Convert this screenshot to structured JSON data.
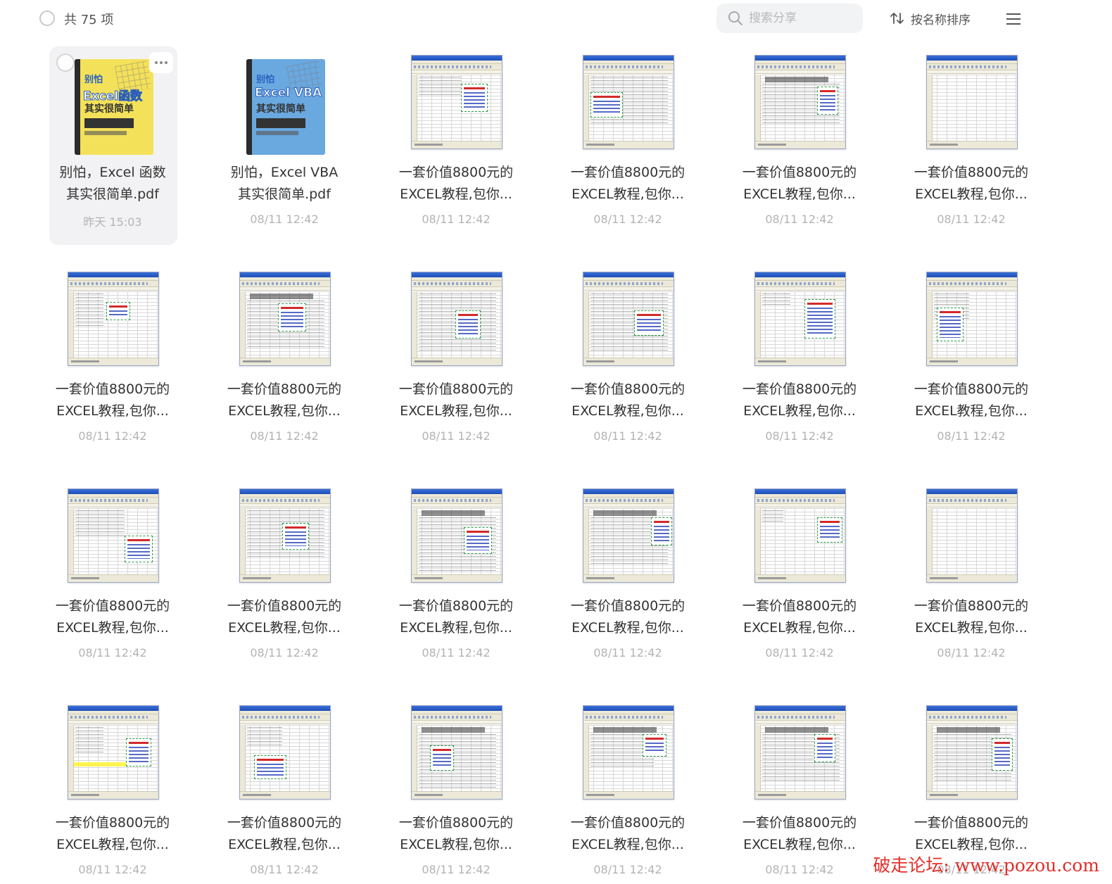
{
  "toolbar": {
    "count_label": "共 75 项",
    "search_placeholder": "搜索分享",
    "sort_label": "按名称排序"
  },
  "files": [
    {
      "name_line1": "别怕，Excel 函数",
      "name_line2": "其实很简单.pdf",
      "time": "昨天 15:03",
      "kind": "book",
      "cover": {
        "line1": "别怕",
        "line2": "Excel函数",
        "line3": "其实很简单",
        "color": "#f4e15a"
      }
    },
    {
      "name_line1": "别怕，Excel VBA",
      "name_line2": "其实很简单.pdf",
      "time": "08/11 12:42",
      "kind": "book",
      "cover": {
        "line1": "别怕",
        "line2": "Excel VBA",
        "line3": "其实很简单",
        "color": "#6aa8e0"
      }
    },
    {
      "name_line1": "一套价值8800元的",
      "name_line2": "EXCEL教程,包你...",
      "time": "08/11 12:42",
      "kind": "xls"
    },
    {
      "name_line1": "一套价值8800元的",
      "name_line2": "EXCEL教程,包你...",
      "time": "08/11 12:42",
      "kind": "xls"
    },
    {
      "name_line1": "一套价值8800元的",
      "name_line2": "EXCEL教程,包你...",
      "time": "08/11 12:42",
      "kind": "xls",
      "sheet_heading": "2003年度工工程一览表"
    },
    {
      "name_line1": "一套价值8800元的",
      "name_line2": "EXCEL教程,包你...",
      "time": "08/11 12:42",
      "kind": "xls"
    },
    {
      "name_line1": "一套价值8800元的",
      "name_line2": "EXCEL教程,包你...",
      "time": "08/11 12:42",
      "kind": "xls"
    },
    {
      "name_line1": "一套价值8800元的",
      "name_line2": "EXCEL教程,包你...",
      "time": "08/11 12:42",
      "kind": "xls"
    },
    {
      "name_line1": "一套价值8800元的",
      "name_line2": "EXCEL教程,包你...",
      "time": "08/11 12:42",
      "kind": "xls"
    },
    {
      "name_line1": "一套价值8800元的",
      "name_line2": "EXCEL教程,包你...",
      "time": "08/11 12:42",
      "kind": "xls"
    },
    {
      "name_line1": "一套价值8800元的",
      "name_line2": "EXCEL教程,包你...",
      "time": "08/11 12:42",
      "kind": "xls"
    },
    {
      "name_line1": "一套价值8800元的",
      "name_line2": "EXCEL教程,包你...",
      "time": "08/11 12:42",
      "kind": "xls"
    },
    {
      "name_line1": "一套价值8800元的",
      "name_line2": "EXCEL教程,包你...",
      "time": "08/11 12:42",
      "kind": "xls"
    },
    {
      "name_line1": "一套价值8800元的",
      "name_line2": "EXCEL教程,包你...",
      "time": "08/11 12:42",
      "kind": "xls"
    },
    {
      "name_line1": "一套价值8800元的",
      "name_line2": "EXCEL教程,包你...",
      "time": "08/11 12:42",
      "kind": "xls"
    },
    {
      "name_line1": "一套价值8800元的",
      "name_line2": "EXCEL教程,包你...",
      "time": "08/11 12:42",
      "kind": "xls"
    },
    {
      "name_line1": "一套价值8800元的",
      "name_line2": "EXCEL教程,包你...",
      "time": "08/11 12:42",
      "kind": "xls"
    },
    {
      "name_line1": "一套价值8800元的",
      "name_line2": "EXCEL教程,包你...",
      "time": "08/11 12:42",
      "kind": "xls"
    },
    {
      "name_line1": "一套价值8800元的",
      "name_line2": "EXCEL教程,包你...",
      "time": "08/11 12:42",
      "kind": "xls"
    },
    {
      "name_line1": "一套价值8800元的",
      "name_line2": "EXCEL教程,包你...",
      "time": "08/11 12:42",
      "kind": "xls"
    },
    {
      "name_line1": "一套价值8800元的",
      "name_line2": "EXCEL教程,包你...",
      "time": "08/11 12:42",
      "kind": "xls"
    },
    {
      "name_line1": "一套价值8800元的",
      "name_line2": "EXCEL教程,包你...",
      "time": "08/11 12:42",
      "kind": "xls"
    },
    {
      "name_line1": "一套价值8800元的",
      "name_line2": "EXCEL教程,包你...",
      "time": "08/11 12:42",
      "kind": "xls",
      "sheet_heading": "2003年度工工程一览表"
    },
    {
      "name_line1": "一套价值8800元的",
      "name_line2": "EXCEL教程,包你...",
      "time": "08/11 12:42",
      "kind": "xls"
    }
  ],
  "watermark": "破走论坛: www.pozou.com",
  "colors": {
    "accent": "#e0302a",
    "selected_bg": "#f2f2f4",
    "search_bg": "#f2f3f5"
  }
}
